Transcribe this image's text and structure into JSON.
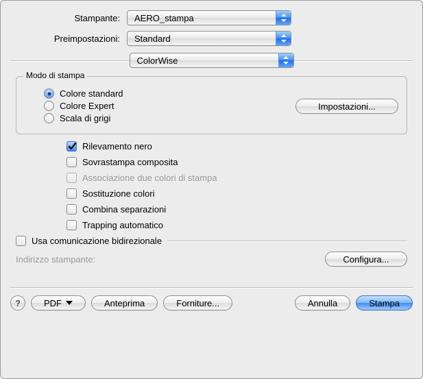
{
  "labels": {
    "printer": "Stampante:",
    "presets": "Preimpostazioni:"
  },
  "popups": {
    "printer": "AERO_stampa",
    "presets": "Standard",
    "pane": "ColorWise"
  },
  "group": {
    "title": "Modo di stampa",
    "radios": {
      "standard": "Colore standard",
      "expert": "Colore Expert",
      "gray": "Scala di grigi"
    },
    "settings_btn": "Impostazioni..."
  },
  "checks": {
    "black": "Rilevamento nero",
    "overprint": "Sovrastampa composita",
    "twocolor": "Associazione due colori di stampa",
    "subst": "Sostituzione colori",
    "combine": "Combina separazioni",
    "trapping": "Trapping automatico"
  },
  "bidir": {
    "check": "Usa comunicazione bidirezionale",
    "addr_label": "Indirizzo stampante:",
    "configure": "Configura..."
  },
  "footer": {
    "help": "?",
    "pdf": "PDF",
    "preview": "Anteprima",
    "supplies": "Forniture...",
    "cancel": "Annulla",
    "print": "Stampa"
  }
}
